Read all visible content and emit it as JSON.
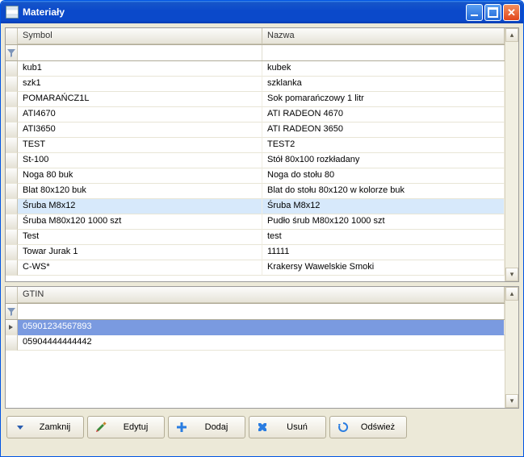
{
  "window": {
    "title": "Materiały"
  },
  "grid1": {
    "columns": {
      "symbol": "Symbol",
      "nazwa": "Nazwa"
    },
    "rows": [
      {
        "symbol": "kub1",
        "nazwa": "kubek"
      },
      {
        "symbol": "szk1",
        "nazwa": "szklanka"
      },
      {
        "symbol": "POMARAŃCZ1L",
        "nazwa": "Sok pomarańczowy 1 litr"
      },
      {
        "symbol": "ATI4670",
        "nazwa": "ATI RADEON 4670"
      },
      {
        "symbol": "ATI3650",
        "nazwa": "ATI RADEON 3650"
      },
      {
        "symbol": "TEST",
        "nazwa": "TEST2"
      },
      {
        "symbol": "St-100",
        "nazwa": "Stół 80x100 rozkładany"
      },
      {
        "symbol": "Noga 80 buk",
        "nazwa": "Noga do stołu 80"
      },
      {
        "symbol": "Blat 80x120 buk",
        "nazwa": "Blat do stołu 80x120 w kolorze buk"
      },
      {
        "symbol": "Śruba M8x12",
        "nazwa": "Śruba M8x12"
      },
      {
        "symbol": "Śruba M80x120 1000 szt",
        "nazwa": "Pudło śrub M80x120 1000 szt"
      },
      {
        "symbol": "Test",
        "nazwa": "test"
      },
      {
        "symbol": "Towar Jurak 1",
        "nazwa": "11111"
      },
      {
        "symbol": "C-WS*",
        "nazwa": "Krakersy Wawelskie Smoki"
      }
    ],
    "selected_index": 9
  },
  "grid2": {
    "columns": {
      "gtin": "GTIN"
    },
    "rows": [
      {
        "gtin": "05901234567893"
      },
      {
        "gtin": "05904444444442"
      }
    ],
    "selected_index": 0
  },
  "toolbar": {
    "close": "Zamknij",
    "edit": "Edytuj",
    "add": "Dodaj",
    "delete": "Usuń",
    "refresh": "Odśwież"
  }
}
